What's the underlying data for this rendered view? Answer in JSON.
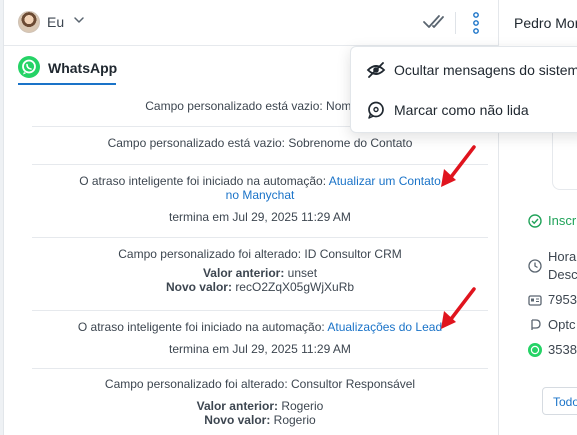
{
  "header": {
    "user_label": "Eu",
    "icons": [
      "user-avatar",
      "chevron-down-icon",
      "double-check-icon",
      "vertical-dots-icon"
    ]
  },
  "tab": {
    "label": "WhatsApp",
    "icon": "whatsapp-icon"
  },
  "feed": {
    "item1": {
      "text": "Campo personalizado está vazio: Nome do"
    },
    "item2": {
      "text": "Campo personalizado está vazio: Sobrenome do Contato"
    },
    "item3": {
      "prefix": "O atraso inteligente foi iniciado na automação:",
      "link_line1": "Atualizar um Contato",
      "link_line2": "no Manychat",
      "ends": "termina em Jul 29, 2025 11:29 AM"
    },
    "item4": {
      "text": "Campo personalizado foi alterado: ID Consultor CRM",
      "prev_label": "Valor anterior:",
      "prev_value": "unset",
      "new_label": "Novo valor:",
      "new_value": "recO2ZqX05gWjXuRb"
    },
    "item5": {
      "prefix": "O atraso inteligente foi iniciado na automação:",
      "link": "Atualizações do Lead",
      "ends": "termina em Jul 29, 2025 11:29 AM"
    },
    "item6": {
      "text": "Campo personalizado foi alterado: Consultor Responsável",
      "prev_label": "Valor anterior:",
      "prev_value": "Rogerio",
      "new_label": "Novo valor:",
      "new_value": "Rogerio"
    }
  },
  "dropdown": {
    "items": [
      {
        "label": "Ocultar mensagens do sistem",
        "icon": "eye-slash-icon"
      },
      {
        "label": "Marcar como não lida",
        "icon": "chat-bubble-icon"
      }
    ]
  },
  "right_panel": {
    "contact_name": "Pedro Mor",
    "status": "Inscr",
    "hours_line1": "Hora",
    "hours_line2": "Desc",
    "id_value": "7953",
    "opt_value": "Optc",
    "phone_value": "3538",
    "button_label": "Todo"
  },
  "colors": {
    "accent": "#1a73c8",
    "whatsapp": "#25d366",
    "annotation": "#e0141e",
    "status_green": "#21a35a"
  }
}
